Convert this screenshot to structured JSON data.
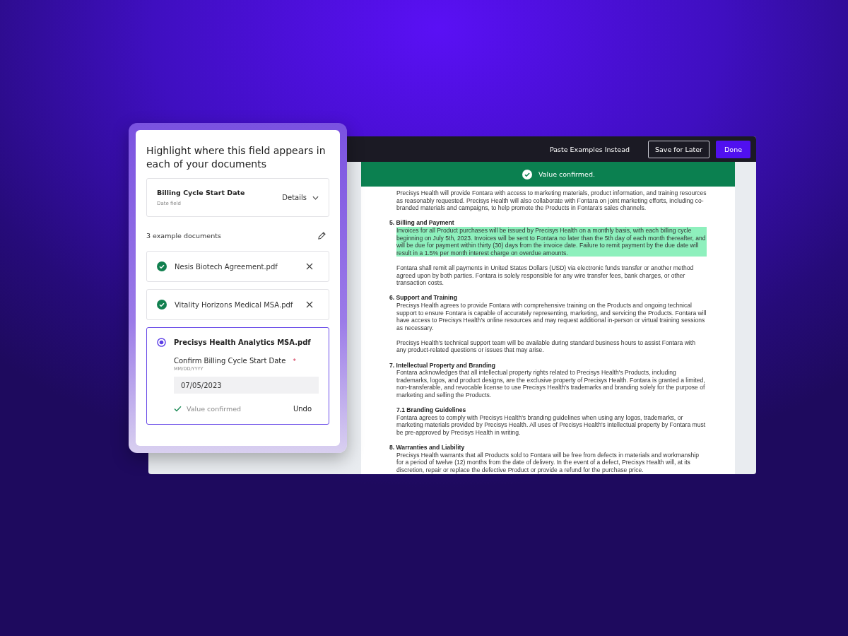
{
  "toolbar": {
    "buttons": [
      {
        "label": "Paste Examples Instead",
        "kind": "text"
      },
      {
        "label": "Save for Later",
        "kind": "outline"
      },
      {
        "label": "Done",
        "kind": "primary"
      }
    ]
  },
  "banner": {
    "message": "Value confirmed."
  },
  "document": {
    "sections": [
      {
        "paragraphs": [
          {
            "text": "Precisys Health will provide Fontara with access to marketing materials, product information, and training resources as reasonably requested. Precisys Health will also collaborate with Fontara on joint marketing efforts, including co-branded materials and campaigns, to help promote the Products in Fontara's sales channels.",
            "highlighted": false
          }
        ]
      },
      {
        "heading": "5. Billing and Payment",
        "kind": "numbered",
        "paragraphs": [
          {
            "text": "Invoices for all Product purchases will be issued by Precisys Health on a monthly basis, with each billing cycle beginning on July 5th, 2023. Invoices will be sent to Fontara no later than the 5th day of each month thereafter, and will be due for payment within thirty (30) days from the invoice date. Failure to remit payment by the due date will result in a 1.5% per month interest charge on overdue amounts.",
            "highlighted": true
          },
          {
            "text": "Fontara shall remit all payments in United States Dollars (USD) via electronic funds transfer or another method agreed upon by both parties. Fontara is solely responsible for any wire transfer fees, bank charges, or other transaction costs.",
            "highlighted": false
          }
        ]
      },
      {
        "heading": "6. Support and Training",
        "kind": "numbered",
        "paragraphs": [
          {
            "text": "Precisys Health agrees to provide Fontara with comprehensive training on the Products and ongoing technical support to ensure Fontara is capable of accurately representing, marketing, and servicing the Products. Fontara will have access to Precisys Health's online resources and may request additional in-person or virtual training sessions as necessary.",
            "highlighted": false
          },
          {
            "text": "Precisys Health's technical support team will be available during standard business hours to assist Fontara with any product-related questions or issues that may arise.",
            "highlighted": false
          }
        ]
      },
      {
        "heading": "7. Intellectual Property and Branding",
        "kind": "numbered",
        "paragraphs": [
          {
            "text": "Fontara acknowledges that all intellectual property rights related to Precisys Health's Products, including trademarks, logos, and product designs, are the exclusive property of Precisys Health. Fontara is granted a limited, non-transferable, and revocable license to use Precisys Health's trademarks and branding solely for the purpose of marketing and selling the Products.",
            "highlighted": false
          }
        ]
      },
      {
        "heading": "7.1 Branding Guidelines",
        "kind": "sub",
        "paragraphs": [
          {
            "text": "Fontara agrees to comply with Precisys Health's branding guidelines when using any logos, trademarks, or marketing materials provided by Precisys Health. All uses of Precisys Health's intellectual property by Fontara must be pre-approved by Precisys Health in writing.",
            "highlighted": false
          }
        ]
      },
      {
        "heading": "8. Warranties and Liability",
        "kind": "numbered",
        "paragraphs": [
          {
            "text": "Precisys Health warrants that all Products sold to Fontara will be free from defects in materials and workmanship for a period of twelve (12) months from the date of delivery. In the event of a defect, Precisys Health will, at its discretion, repair or replace the defective Product or provide a refund for the purchase price.",
            "highlighted": false
          }
        ]
      }
    ]
  },
  "panel": {
    "title": "Highlight where this field appears in each of your documents",
    "field": {
      "name": "Billing Cycle Start Date",
      "type": "Date field",
      "details": "Details"
    },
    "documents_count": "3 example documents",
    "documents": [
      {
        "name": "Nesis Biotech Agreement.pdf",
        "selected": false
      },
      {
        "name": "Vitality Horizons Medical MSA.pdf",
        "selected": false
      },
      {
        "name": "Precisys Health Analytics MSA.pdf",
        "selected": true,
        "confirm_label": "Confirm Billing Cycle Start Date",
        "required_mark": "*",
        "format_hint": "MM/DD/YYYY",
        "value": "07/05/2023",
        "confirmation": "Value confirmed",
        "undo": "Undo"
      }
    ]
  }
}
